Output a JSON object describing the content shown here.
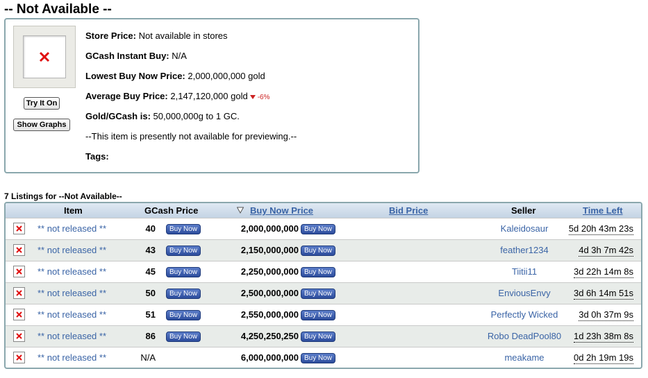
{
  "page": {
    "title": "-- Not Available --"
  },
  "item_info": {
    "thumbnail_icon": "broken-image-icon",
    "try_it_on_label": "Try It On",
    "show_graphs_label": "Show Graphs",
    "store_price_label": "Store Price:",
    "store_price_value": "Not available in stores",
    "gcash_instant_buy_label": "GCash Instant Buy:",
    "gcash_instant_buy_value": "N/A",
    "lowest_buy_now_label": "Lowest Buy Now Price:",
    "lowest_buy_now_value": "2,000,000,000 gold",
    "average_buy_label": "Average Buy Price:",
    "average_buy_value": "2,147,120,000 gold",
    "average_buy_change": "-6%",
    "gold_gcash_label": "Gold/GCash is:",
    "gold_gcash_value": "50,000,000g to 1 GC.",
    "preview_note": "--This item is presently not available for previewing.--",
    "tags_label": "Tags:"
  },
  "listings": {
    "title": "7 Listings for --Not Available--",
    "columns": {
      "item": "Item",
      "gcash_price": "GCash Price",
      "buy_now_price": "Buy Now Price",
      "bid_price": "Bid Price",
      "seller": "Seller",
      "time_left": "Time Left"
    },
    "buy_now_label": "Buy Now",
    "rows": [
      {
        "item": "** not released **",
        "gcash": "40",
        "price": "2,000,000,000",
        "seller": "Kaleidosaur",
        "time_left": "5d 20h 43m 23s"
      },
      {
        "item": "** not released **",
        "gcash": "43",
        "price": "2,150,000,000",
        "seller": "feather1234",
        "time_left": "4d 3h 7m 42s"
      },
      {
        "item": "** not released **",
        "gcash": "45",
        "price": "2,250,000,000",
        "seller": "Tiitii11",
        "time_left": "3d 22h 14m 8s"
      },
      {
        "item": "** not released **",
        "gcash": "50",
        "price": "2,500,000,000",
        "seller": "EnviousEnvy",
        "time_left": "3d 6h 14m 51s"
      },
      {
        "item": "** not released **",
        "gcash": "51",
        "price": "2,550,000,000",
        "seller": "Perfectly Wicked",
        "time_left": "3d 0h 37m 9s"
      },
      {
        "item": "** not released **",
        "gcash": "86",
        "price": "4,250,250,250",
        "seller": "Robo DeadPool80",
        "time_left": "1d 23h 38m 8s"
      },
      {
        "item": "** not released **",
        "gcash": "N/A",
        "price": "6,000,000,000",
        "seller": "meakame",
        "time_left": "0d 2h 19m 19s"
      }
    ]
  },
  "colors": {
    "link": "#3a64a6",
    "buy_button": "#2c4c9c",
    "border": "#8aa7ad",
    "alt_row": "#e8ece9",
    "change_down": "#cc2222"
  }
}
